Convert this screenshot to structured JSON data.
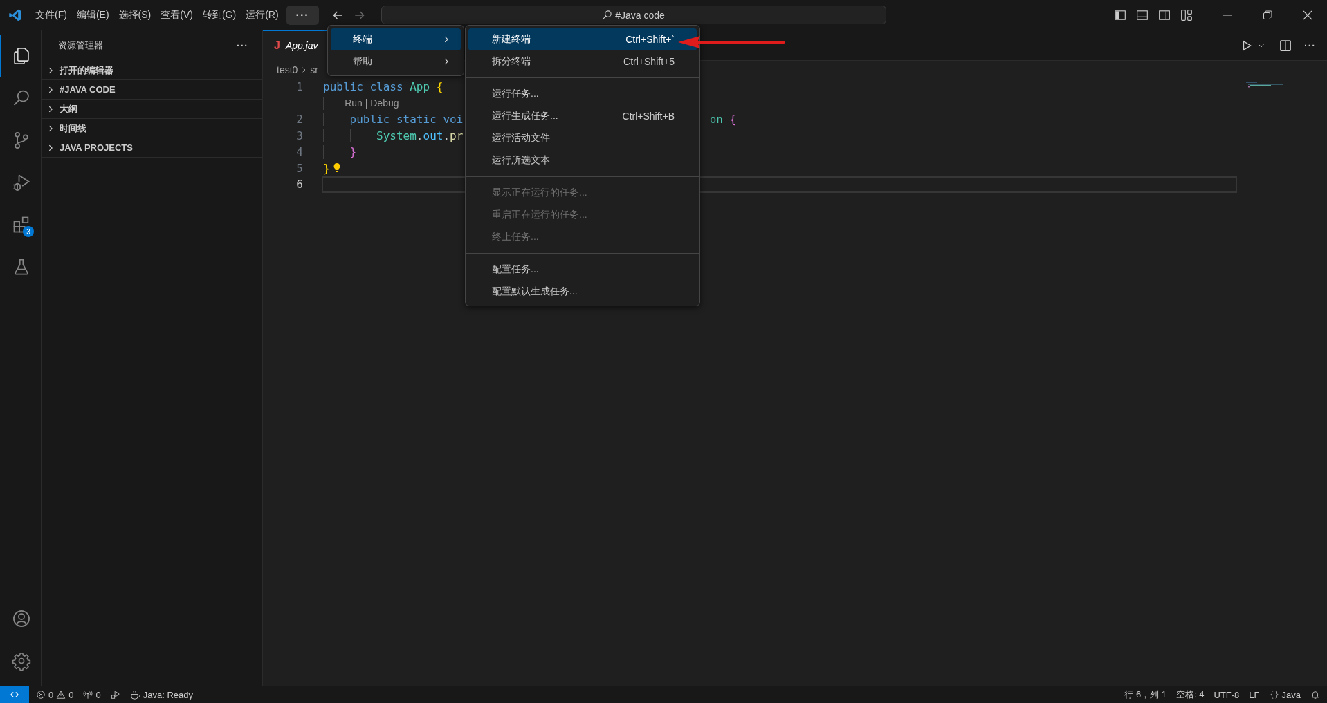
{
  "title_bar": {
    "menus": [
      {
        "label": "文件(F)"
      },
      {
        "label": "编辑(E)"
      },
      {
        "label": "选择(S)"
      },
      {
        "label": "查看(V)"
      },
      {
        "label": "转到(G)"
      },
      {
        "label": "运行(R)"
      }
    ],
    "more_button": {
      "label": "···",
      "selected": true
    },
    "back_enabled": true,
    "forward_enabled": false,
    "command_center": {
      "text": "#Java code"
    }
  },
  "activity_bar": {
    "items": [
      {
        "kind": "explorer",
        "selected": true
      },
      {
        "kind": "search",
        "selected": false
      },
      {
        "kind": "source-control",
        "selected": false
      },
      {
        "kind": "run-debug",
        "selected": false
      },
      {
        "kind": "extensions",
        "selected": false,
        "badge": "3"
      },
      {
        "kind": "testing",
        "selected": false
      }
    ],
    "bottom": [
      {
        "kind": "account"
      },
      {
        "kind": "settings"
      }
    ]
  },
  "sidebar": {
    "title": "资源管理器",
    "more": "···",
    "sections": [
      {
        "label": "打开的编辑器",
        "expanded": false
      },
      {
        "label": "#JAVA CODE",
        "expanded": false
      },
      {
        "label": "大纲",
        "expanded": false
      },
      {
        "label": "时间线",
        "expanded": false
      },
      {
        "label": "JAVA PROJECTS",
        "expanded": false
      }
    ]
  },
  "editor": {
    "tabs": [
      {
        "label": "App.jav",
        "icon": "J",
        "selected": true
      }
    ],
    "toolbar_more": "···",
    "breadcrumb": [
      "test0",
      "sr"
    ],
    "lines": [
      {
        "kind": "code",
        "number": "1",
        "current": false,
        "tokens": [
          {
            "text": "public ",
            "color": "#569cd6"
          },
          {
            "text": "class ",
            "color": "#569cd6"
          },
          {
            "text": "App ",
            "color": "#4ec9b0"
          },
          {
            "text": "{",
            "color": "#ffd700"
          }
        ]
      },
      {
        "kind": "codelens",
        "text": "Run | Debug"
      },
      {
        "kind": "code",
        "number": "2",
        "current": false,
        "tokens": [
          {
            "text": "    public ",
            "color": "#569cd6"
          },
          {
            "text": "static ",
            "color": "#569cd6"
          },
          {
            "text": "voi",
            "color": "#569cd6"
          }
        ],
        "tail": [
          {
            "text": "on ",
            "color": "#4ec9b0"
          },
          {
            "text": "{",
            "color": "#da70d6"
          }
        ]
      },
      {
        "kind": "code",
        "number": "3",
        "current": false,
        "tokens": [
          {
            "text": "        System",
            "color": "#4ec9b0"
          },
          {
            "text": "."
          },
          {
            "text": "out",
            "color": "#4fc1ff"
          },
          {
            "text": "."
          },
          {
            "text": "pr",
            "color": "#dcdcaa"
          }
        ]
      },
      {
        "kind": "code",
        "number": "4",
        "current": false,
        "tokens": [
          {
            "text": "    }",
            "color": "#da70d6"
          }
        ]
      },
      {
        "kind": "code",
        "number": "5",
        "current": false,
        "lightbulb": true,
        "tokens": [
          {
            "text": "}",
            "color": "#ffd700"
          }
        ]
      },
      {
        "kind": "code",
        "number": "6",
        "current": true
      }
    ]
  },
  "menu": {
    "items": [
      {
        "label": "终端",
        "selected": true,
        "submenu": true
      },
      {
        "label": "帮助",
        "selected": false,
        "submenu": true
      }
    ]
  },
  "submenu": {
    "groups": [
      {
        "items": [
          {
            "label": "新建终端",
            "shortcut": "Ctrl+Shift+`",
            "selected": true,
            "disabled": false
          },
          {
            "label": "拆分终端",
            "shortcut": "Ctrl+Shift+5",
            "selected": false,
            "disabled": false
          }
        ]
      },
      {
        "items": [
          {
            "label": "运行任务...",
            "selected": false,
            "disabled": false
          },
          {
            "label": "运行生成任务...",
            "shortcut": "Ctrl+Shift+B",
            "selected": false,
            "disabled": false
          },
          {
            "label": "运行活动文件",
            "selected": false,
            "disabled": false
          },
          {
            "label": "运行所选文本",
            "selected": false,
            "disabled": false
          }
        ]
      },
      {
        "items": [
          {
            "label": "显示正在运行的任务...",
            "selected": false,
            "disabled": true
          },
          {
            "label": "重启正在运行的任务...",
            "selected": false,
            "disabled": true
          },
          {
            "label": "终止任务...",
            "selected": false,
            "disabled": true
          }
        ]
      },
      {
        "items": [
          {
            "label": "配置任务...",
            "selected": false,
            "disabled": false
          },
          {
            "label": "配置默认生成任务...",
            "selected": false,
            "disabled": false
          }
        ]
      }
    ]
  },
  "status_bar": {
    "left": [
      {
        "kind": "problems",
        "errors": "0",
        "warnings": "0"
      },
      {
        "kind": "ports",
        "text": "0"
      },
      {
        "kind": "launch"
      },
      {
        "kind": "java",
        "text": "Java: Ready"
      }
    ],
    "right": [
      {
        "kind": "text",
        "text": "行 6，列 1"
      },
      {
        "kind": "text",
        "text": "空格: 4"
      },
      {
        "kind": "text",
        "text": "UTF-8"
      },
      {
        "kind": "text",
        "text": "LF"
      },
      {
        "kind": "language",
        "text": "Java"
      },
      {
        "kind": "bell"
      }
    ]
  }
}
